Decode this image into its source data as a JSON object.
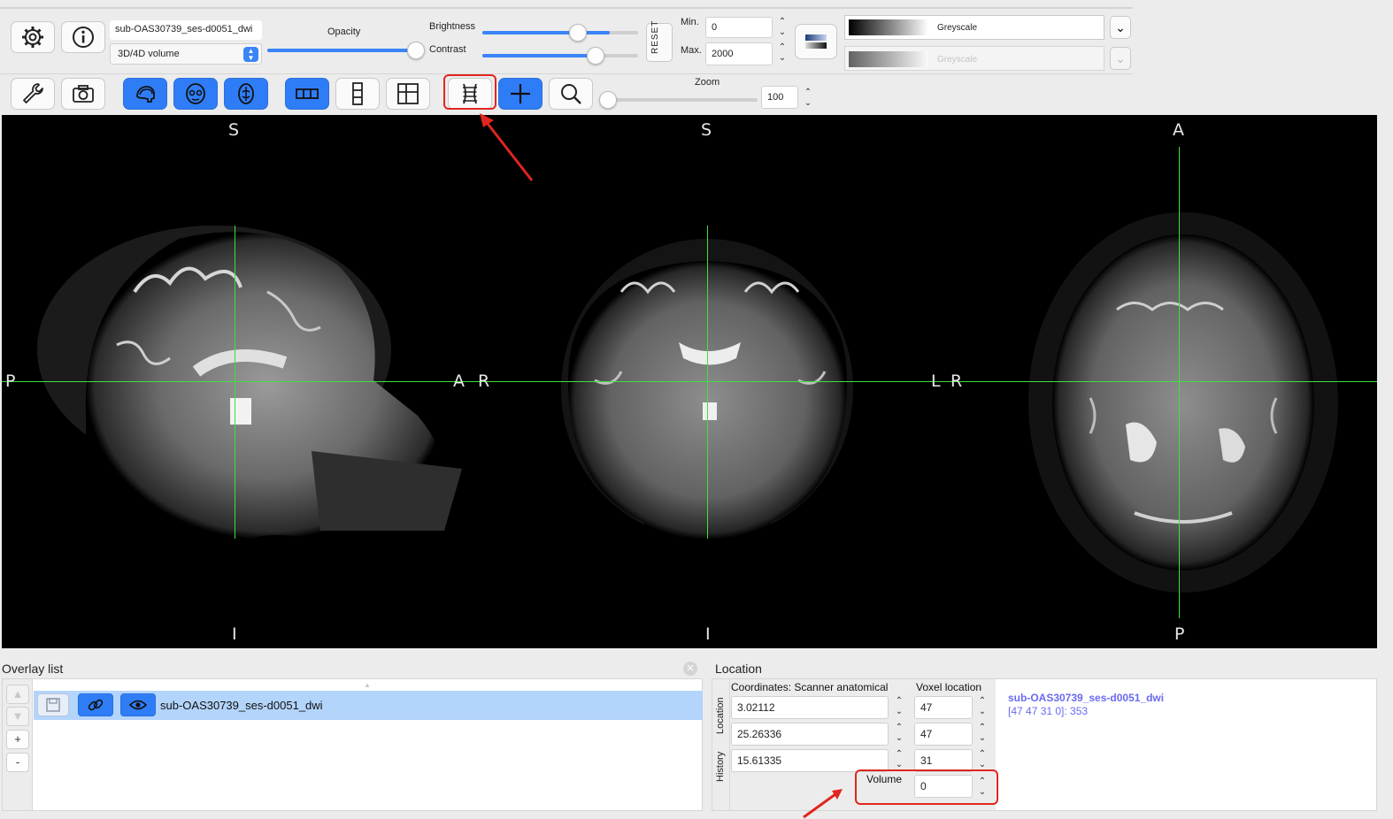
{
  "toolbar": {
    "image_name": "sub-OAS30739_ses-d0051_dwi",
    "image_type": "3D/4D volume",
    "opacity_label": "Opacity",
    "brightness_label": "Brightness",
    "contrast_label": "Contrast",
    "reset_label": "RESET",
    "min_label": "Min.",
    "min_value": "0",
    "max_label": "Max.",
    "max_value": "2000",
    "cmap_primary": "Greyscale",
    "cmap_secondary": "Greyscale",
    "zoom_label": "Zoom",
    "zoom_value": "100",
    "levels": {
      "opacity": 1.0,
      "brightness": 0.82,
      "contrast": 0.73,
      "zoom": 0.0
    }
  },
  "view": {
    "sagittal": {
      "top": "S",
      "bottom": "I",
      "left": "P",
      "right": "A"
    },
    "coronal": {
      "top": "S",
      "bottom": "I",
      "left": "R",
      "right": "L"
    },
    "axial": {
      "top": "A",
      "bottom": "P",
      "left": "R"
    }
  },
  "overlay_list": {
    "title": "Overlay list",
    "item_name": "sub-OAS30739_ses-d0051_dwi",
    "buttons": [
      "▲",
      "▼",
      "+",
      "-"
    ]
  },
  "location": {
    "title": "Location",
    "coord_header": "Coordinates: Scanner anatomical",
    "voxel_header": "Voxel location",
    "side_tab_location": "Location",
    "side_tab_history": "History",
    "coords": [
      "3.02112",
      "25.26336",
      "15.61335"
    ],
    "voxels": [
      "47",
      "47",
      "31"
    ],
    "volume_label": "Volume",
    "volume_value": "0",
    "info_name": "sub-OAS30739_ses-d0051_dwi",
    "info_value": "[47 47 31 0]: 353"
  },
  "colors": {
    "accent": "#2f7df6",
    "crosshair": "#3fe03f",
    "annotation": "#e0261f",
    "info_text": "#6a6af0"
  }
}
